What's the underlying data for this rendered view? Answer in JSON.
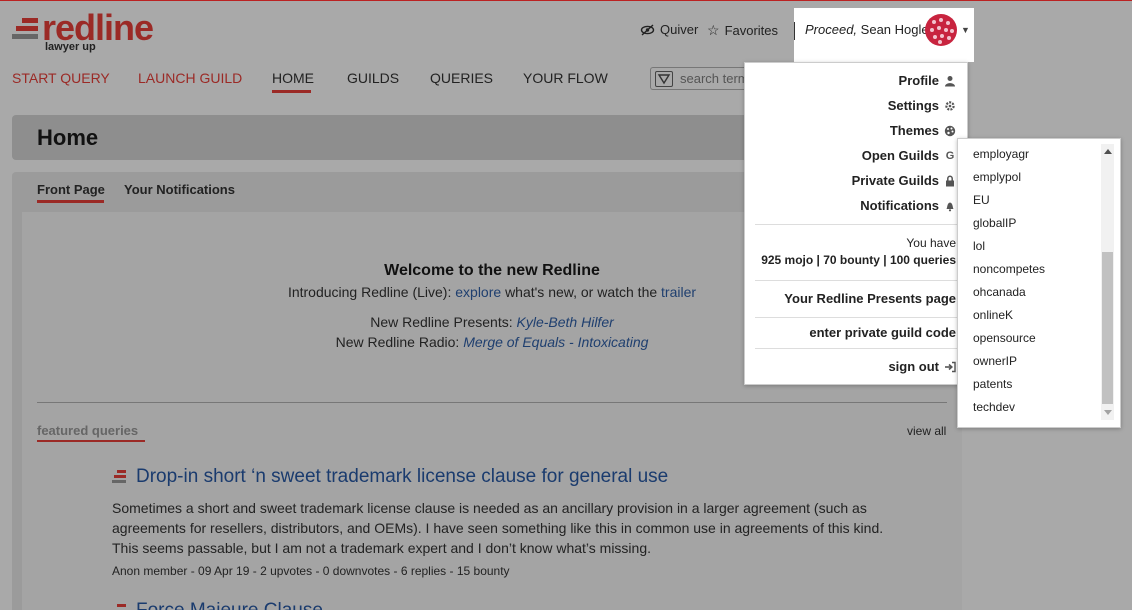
{
  "brand": {
    "name": "redline",
    "tagline": "lawyer up",
    "accent_color": "#9b2a26",
    "link_color": "#1f3f6f"
  },
  "header": {
    "quiver_label": "Quiver",
    "favorites_label": "Favorites",
    "user_greeting": "Proceed,",
    "user_name": "Sean Hogle"
  },
  "nav": {
    "start_query": "START QUERY",
    "launch_guild": "LAUNCH GUILD",
    "home": "HOME",
    "guilds": "GUILDS",
    "queries": "QUERIES",
    "your_flow": "YOUR FLOW"
  },
  "search": {
    "placeholder": "search terms"
  },
  "page": {
    "title": "Home",
    "tabs": [
      "Front Page",
      "Your Notifications"
    ],
    "active_tab": "Front Page"
  },
  "welcome": {
    "title": "Welcome to the new Redline",
    "intro_prefix": "Introducing Redline (Live):",
    "explore_link": "explore",
    "intro_middle": "what's new, or watch the",
    "trailer_link": "trailer",
    "presents_prefix": "New Redline Presents:",
    "presents_link": "Kyle-Beth Hilfer",
    "radio_prefix": "New Redline Radio:",
    "radio_link": "Merge of Equals - Intoxicating"
  },
  "featured": {
    "heading": "featured queries",
    "view_all": "view all",
    "queries": [
      {
        "title": "Drop-in short ‘n sweet trademark license clause for general use",
        "body": "Sometimes a short and sweet trademark license clause is needed as an ancillary provision in a larger agreement (such as agreements for resellers, distributors, and OEMs).   I have seen something like this in common use in agreements of this kind. This seems passable, but I am not a trademark expert and I don’t know what’s missing.",
        "meta": "Anon member - 09 Apr 19 - 2 upvotes - 0 downvotes - 6 replies - 15 bounty"
      },
      {
        "title": "Force Majeure Clause"
      }
    ]
  },
  "user_menu": {
    "items": [
      {
        "label": "Profile",
        "icon": "person-icon"
      },
      {
        "label": "Settings",
        "icon": "gear-icon"
      },
      {
        "label": "Themes",
        "icon": "palette-icon"
      },
      {
        "label": "Open Guilds",
        "icon": "guild-g-icon"
      },
      {
        "label": "Private Guilds",
        "icon": "lock-icon"
      },
      {
        "label": "Notifications",
        "icon": "bell-icon"
      }
    ],
    "you_have": "You have",
    "stats": "925 mojo | 70 bounty | 100 queries",
    "presents_page": "Your Redline Presents page",
    "private_code": "enter private guild code",
    "sign_out": "sign out"
  },
  "guild_list": {
    "items": [
      "employagr",
      "emplypol",
      "EU",
      "globalIP",
      "lol",
      "noncompetes",
      "ohcanada",
      "onlineK",
      "opensource",
      "ownerIP",
      "patents",
      "techdev"
    ]
  }
}
